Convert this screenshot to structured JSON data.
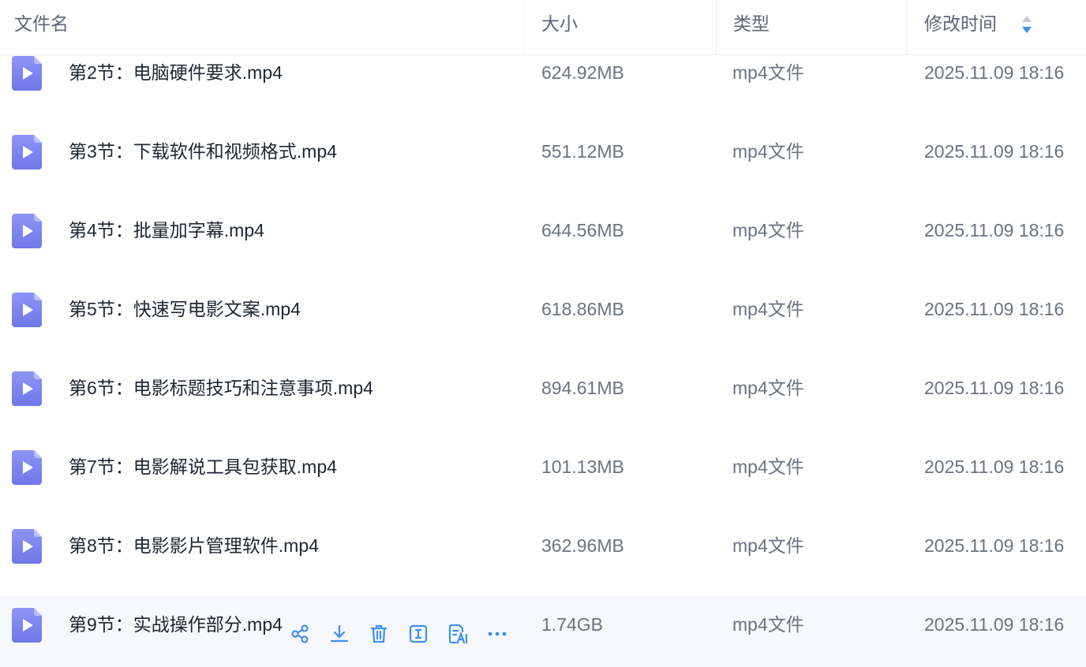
{
  "header": {
    "name": "文件名",
    "size": "大小",
    "type": "类型",
    "time": "修改时间",
    "sort_icon": "sort-desc-icon"
  },
  "colors": {
    "accent": "#3e8ff0",
    "file_icon": "#7c86f0",
    "hover_row": "#f6f8fb"
  },
  "rows": [
    {
      "name": "第2节：电脑硬件要求.mp4",
      "size": "624.92MB",
      "type": "mp4文件",
      "time": "2025.11.09 18:16",
      "icon": "video-file-icon"
    },
    {
      "name": "第3节：下载软件和视频格式.mp4",
      "size": "551.12MB",
      "type": "mp4文件",
      "time": "2025.11.09 18:16",
      "icon": "video-file-icon"
    },
    {
      "name": "第4节：批量加字幕.mp4",
      "size": "644.56MB",
      "type": "mp4文件",
      "time": "2025.11.09 18:16",
      "icon": "video-file-icon"
    },
    {
      "name": "第5节：快速写电影文案.mp4",
      "size": "618.86MB",
      "type": "mp4文件",
      "time": "2025.11.09 18:16",
      "icon": "video-file-icon"
    },
    {
      "name": "第6节：电影标题技巧和注意事项.mp4",
      "size": "894.61MB",
      "type": "mp4文件",
      "time": "2025.11.09 18:16",
      "icon": "video-file-icon"
    },
    {
      "name": "第7节：电影解说工具包获取.mp4",
      "size": "101.13MB",
      "type": "mp4文件",
      "time": "2025.11.09 18:16",
      "icon": "video-file-icon"
    },
    {
      "name": "第8节：电影影片管理软件.mp4",
      "size": "362.96MB",
      "type": "mp4文件",
      "time": "2025.11.09 18:16",
      "icon": "video-file-icon"
    },
    {
      "name": "第9节：实战操作部分.mp4",
      "size": "1.74GB",
      "type": "mp4文件",
      "time": "2025.11.09 18:16",
      "icon": "video-file-icon"
    }
  ],
  "row_actions": [
    "share-icon",
    "download-icon",
    "delete-icon",
    "rename-icon",
    "ai-summary-icon",
    "more-icon"
  ]
}
